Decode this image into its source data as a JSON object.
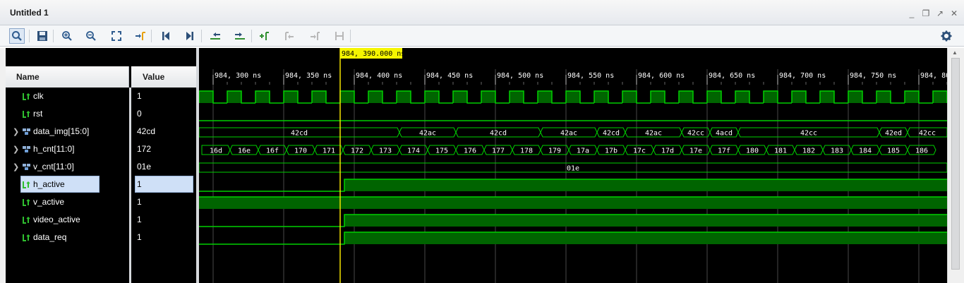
{
  "window": {
    "title": "Untitled 1"
  },
  "icons": {
    "minimize": "_",
    "restore": "❐",
    "float": "↗",
    "close": "✕"
  },
  "columns": {
    "name": "Name",
    "value": "Value"
  },
  "cursor": {
    "label": "984, 390.000 ns",
    "time": 984390
  },
  "timeline": {
    "start": 984290,
    "end": 984820,
    "ticks": [
      {
        "t": 984300,
        "label": "984, 300 ns"
      },
      {
        "t": 984350,
        "label": "984, 350 ns"
      },
      {
        "t": 984400,
        "label": "984, 400 ns"
      },
      {
        "t": 984450,
        "label": "984, 450 ns"
      },
      {
        "t": 984500,
        "label": "984, 500 ns"
      },
      {
        "t": 984550,
        "label": "984, 550 ns"
      },
      {
        "t": 984600,
        "label": "984, 600 ns"
      },
      {
        "t": 984650,
        "label": "984, 650 ns"
      },
      {
        "t": 984700,
        "label": "984, 700 ns"
      },
      {
        "t": 984750,
        "label": "984, 750 ns"
      },
      {
        "t": 984800,
        "label": "984, 80"
      }
    ]
  },
  "signals": [
    {
      "name": "clk",
      "value": "1",
      "kind": "bit",
      "expandable": false,
      "selected": false
    },
    {
      "name": "rst",
      "value": "0",
      "kind": "bit",
      "expandable": false,
      "selected": false
    },
    {
      "name": "data_img[15:0]",
      "value": "42cd",
      "kind": "bus",
      "expandable": true,
      "selected": false
    },
    {
      "name": "h_cnt[11:0]",
      "value": "172",
      "kind": "bus",
      "expandable": true,
      "selected": false
    },
    {
      "name": "v_cnt[11:0]",
      "value": "01e",
      "kind": "bus",
      "expandable": true,
      "selected": false
    },
    {
      "name": "h_active",
      "value": "1",
      "kind": "bit",
      "expandable": false,
      "selected": true
    },
    {
      "name": "v_active",
      "value": "1",
      "kind": "bit",
      "expandable": false,
      "selected": false
    },
    {
      "name": "video_active",
      "value": "1",
      "kind": "bit",
      "expandable": false,
      "selected": false
    },
    {
      "name": "data_req",
      "value": "1",
      "kind": "bit",
      "expandable": false,
      "selected": false
    }
  ],
  "waves": {
    "clk": {
      "period": 20,
      "first_rise": 984290,
      "high": 10
    },
    "rst": {
      "level": 0
    },
    "data_img": [
      {
        "t0": 984290,
        "t1": 984432,
        "label": "42cd"
      },
      {
        "t0": 984432,
        "t1": 984472,
        "label": "42ac"
      },
      {
        "t0": 984472,
        "t1": 984532,
        "label": "42cd"
      },
      {
        "t0": 984532,
        "t1": 984572,
        "label": "42ac"
      },
      {
        "t0": 984572,
        "t1": 984592,
        "label": "42cd"
      },
      {
        "t0": 984592,
        "t1": 984632,
        "label": "42ac"
      },
      {
        "t0": 984632,
        "t1": 984652,
        "label": "42cc"
      },
      {
        "t0": 984652,
        "t1": 984672,
        "label": "4acd"
      },
      {
        "t0": 984672,
        "t1": 984772,
        "label": "42cc"
      },
      {
        "t0": 984772,
        "t1": 984792,
        "label": "42ed"
      },
      {
        "t0": 984792,
        "t1": 984820,
        "label": "42cc"
      }
    ],
    "h_cnt": {
      "start": 984292,
      "step": 20,
      "values": [
        "16d",
        "16e",
        "16f",
        "170",
        "171",
        "172",
        "173",
        "174",
        "175",
        "176",
        "177",
        "178",
        "179",
        "17a",
        "17b",
        "17c",
        "17d",
        "17e",
        "17f",
        "180",
        "181",
        "182",
        "183",
        "184",
        "185",
        "186"
      ]
    },
    "v_cnt": {
      "label": "01e"
    },
    "h_active": {
      "low_until": 984393,
      "level_after": 1
    },
    "v_active": {
      "level": 1
    },
    "video_active": {
      "low_until": 984393,
      "level_after": 1
    },
    "data_req": {
      "low_until": 984393,
      "level_after": 1
    }
  }
}
